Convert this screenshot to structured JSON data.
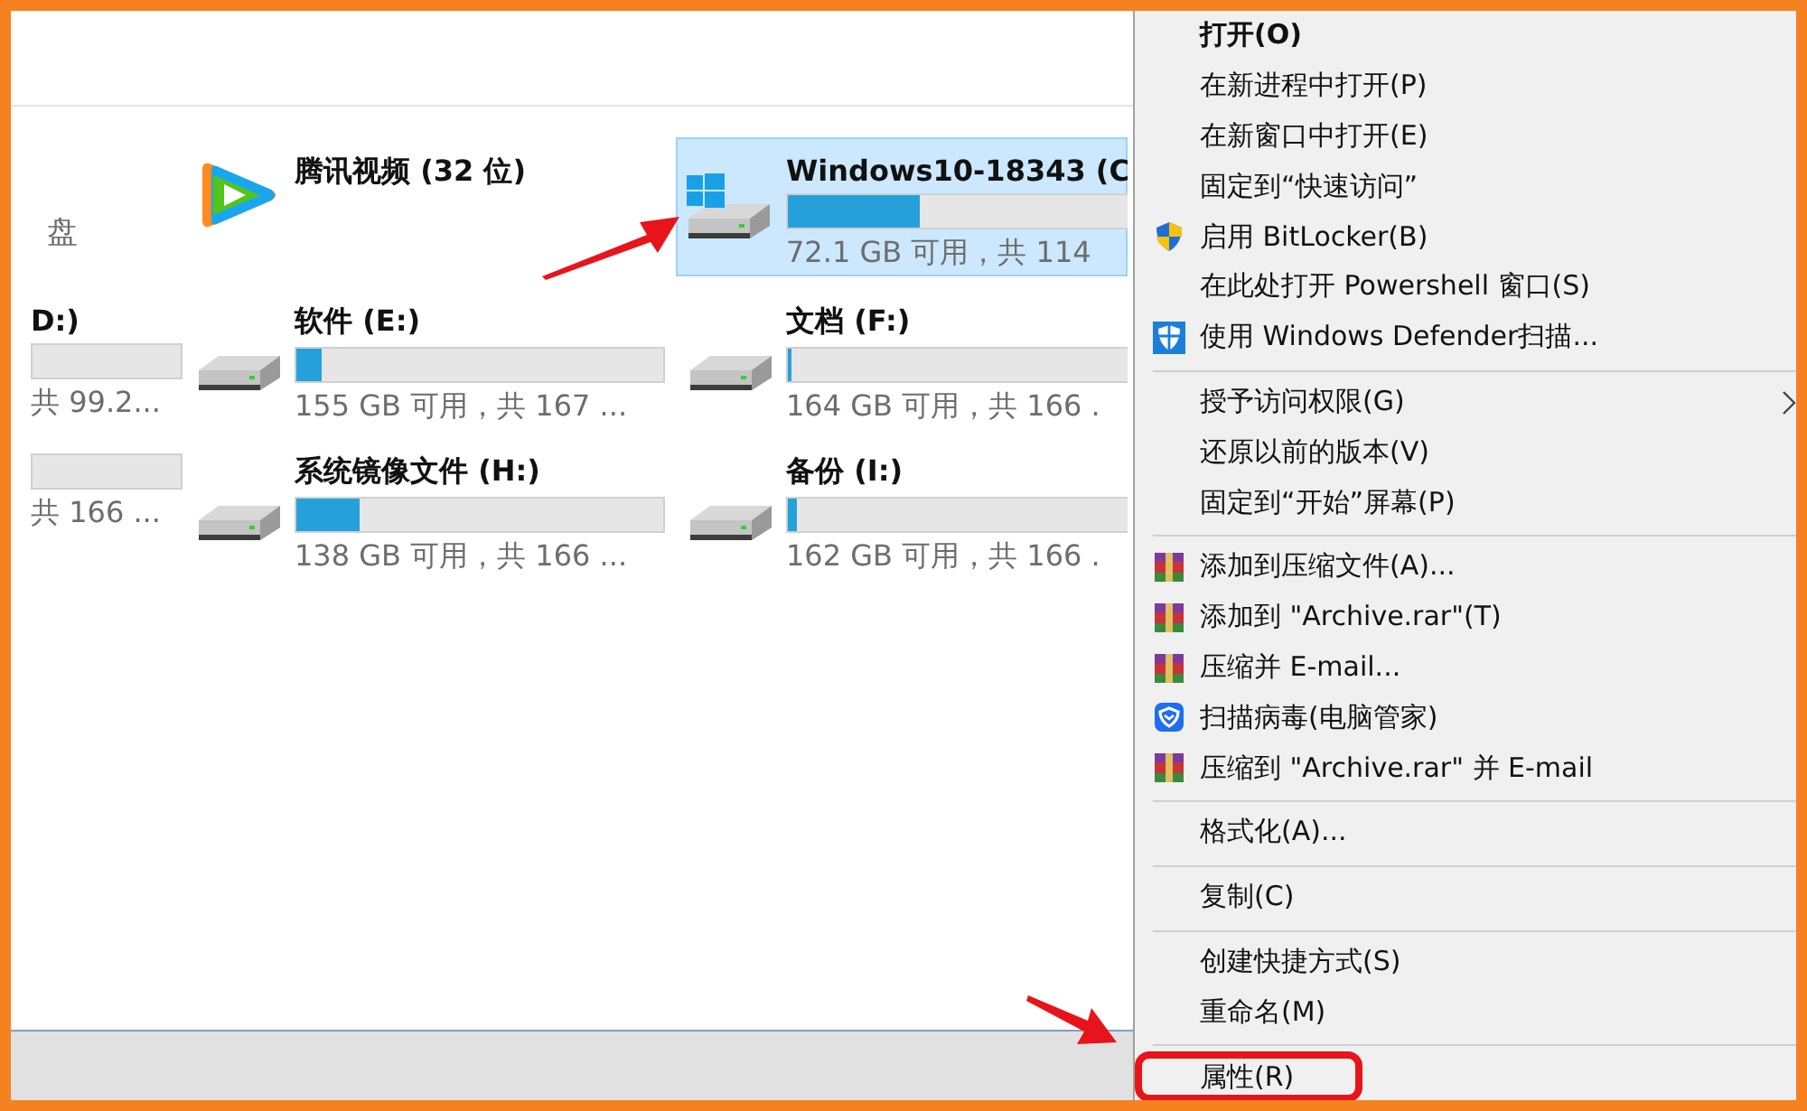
{
  "drive_columns": [
    [
      {
        "kind": "label",
        "name": "盘"
      },
      {
        "kind": "partial",
        "name": "D:)",
        "free": "共 99.2..."
      },
      {
        "kind": "partial",
        "free": "共 166 ..."
      }
    ],
    [
      {
        "kind": "app",
        "name": "腾讯视频 (32 位)",
        "selected": false
      },
      {
        "kind": "drive",
        "name": "软件 (E:)",
        "level": 0.07,
        "free": "155 GB 可用，共 167 ...",
        "selected": false
      },
      {
        "kind": "drive",
        "name": "系统镜像文件 (H:)",
        "level": 0.17,
        "free": "138 GB 可用，共 166 ...",
        "selected": false
      }
    ],
    [
      {
        "kind": "system",
        "name": "Windows10-18343 (C",
        "level": 0.37,
        "free": "72.1 GB 可用，共 114",
        "selected": true
      },
      {
        "kind": "drive",
        "name": "文档 (F:)",
        "level": 0.012,
        "free": "164 GB 可用，共 166 .",
        "selected": false
      },
      {
        "kind": "drive",
        "name": "备份 (I:)",
        "level": 0.024,
        "free": "162 GB 可用，共 166 .",
        "selected": false
      }
    ]
  ],
  "context_menu": [
    {
      "kind": "item",
      "label": "打开(O)",
      "default": true
    },
    {
      "kind": "item",
      "label": "在新进程中打开(P)"
    },
    {
      "kind": "item",
      "label": "在新窗口中打开(E)"
    },
    {
      "kind": "item",
      "label": "固定到“快速访问”"
    },
    {
      "kind": "uac",
      "label": "启用 BitLocker(B)"
    },
    {
      "kind": "item",
      "label": "在此处打开 Powershell 窗口(S)"
    },
    {
      "kind": "defender",
      "label": "使用 Windows Defender扫描..."
    },
    {
      "kind": "separator"
    },
    {
      "kind": "item",
      "label": "授予访问权限(G)",
      "submenu": true
    },
    {
      "kind": "item",
      "label": "还原以前的版本(V)"
    },
    {
      "kind": "item",
      "label": "固定到“开始”屏幕(P)"
    },
    {
      "kind": "separator"
    },
    {
      "kind": "archive",
      "label": "添加到压缩文件(A)..."
    },
    {
      "kind": "archive",
      "label": "添加到 \"Archive.rar\"(T)"
    },
    {
      "kind": "archive",
      "label": "压缩并 E-mail..."
    },
    {
      "kind": "guard",
      "label": "扫描病毒(电脑管家)"
    },
    {
      "kind": "archive",
      "label": "压缩到 \"Archive.rar\" 并 E-mail"
    },
    {
      "kind": "separator"
    },
    {
      "kind": "item",
      "label": "格式化(A)..."
    },
    {
      "kind": "separator"
    },
    {
      "kind": "item",
      "label": "复制(C)"
    },
    {
      "kind": "separator"
    },
    {
      "kind": "item",
      "label": "创建快捷方式(S)"
    },
    {
      "kind": "item",
      "label": "重命名(M)"
    },
    {
      "kind": "separator"
    },
    {
      "kind": "item",
      "label": "属性(R)",
      "highlighted": true
    }
  ]
}
